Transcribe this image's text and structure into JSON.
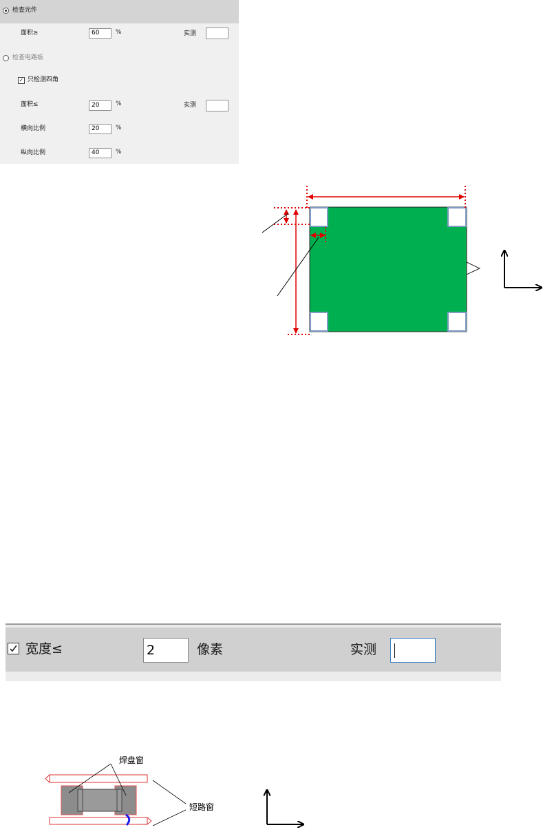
{
  "panel1": {
    "option_component": {
      "label": "检查元件",
      "selected": true
    },
    "component_area": {
      "label": "面积≥",
      "value": "60",
      "unit": "%",
      "measured_label": "实测",
      "measured_value": ""
    },
    "option_board": {
      "label": "检查电路板",
      "selected": false
    },
    "corners_only": {
      "label": "只检测四角",
      "checked": true
    },
    "board_area": {
      "label": "面积≤",
      "value": "20",
      "unit": "%",
      "measured_label": "实测",
      "measured_value": ""
    },
    "horizontal_ratio": {
      "label": "横向比例",
      "value": "20",
      "unit": "%"
    },
    "vertical_ratio": {
      "label": "纵向比例",
      "value": "40",
      "unit": "%"
    }
  },
  "diagram1": {
    "board_color": "#00b050",
    "dimension_color": "#e00000",
    "corner_pad_color": "#8fa8c8"
  },
  "panel2": {
    "width_checkbox": {
      "label": "宽度≤",
      "checked": true
    },
    "width_value": "2",
    "unit": "像素",
    "measured_label": "实测",
    "measured_value": ""
  },
  "diagram2": {
    "pad_window_label": "焊盘窗",
    "short_window_label": "短路窗"
  }
}
